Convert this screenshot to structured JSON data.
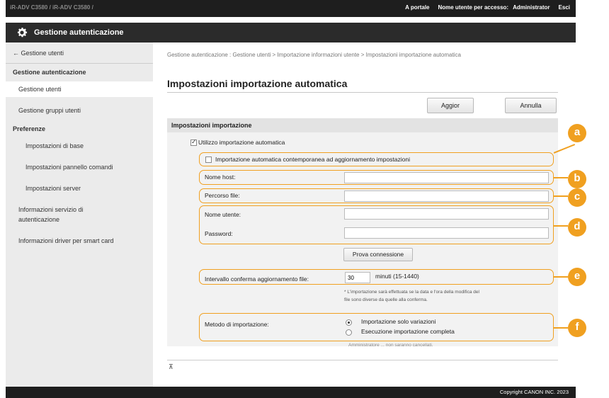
{
  "topbar": {
    "device_name": "iR-ADV C3580 / iR-ADV C3580 /",
    "portal_link": "A portale",
    "user_label": "Nome utente per accesso:",
    "user_value": "Administrator",
    "logout_link": "Esci"
  },
  "titlebar": {
    "title": "Gestione autenticazione",
    "icon": "gear-icon"
  },
  "sidebar": {
    "back_link": "← Gestione utenti",
    "section_auth": "Gestione autenticazione",
    "item_users": "Gestione utenti",
    "item_groups": "Gestione gruppi utenti",
    "section_pref": "Preferenze",
    "item_basic": "Impostazioni di base",
    "item_panel": "Impostazioni pannello comandi",
    "item_server": "Impostazioni server",
    "item_service_info_line1": "Informazioni servizio di",
    "item_service_info_line2": "autenticazione",
    "item_driver": "Informazioni driver per smart card"
  },
  "main": {
    "breadcrumb": "Gestione autenticazione : Gestione utenti > Importazione informazioni utente > Impostazioni importazione automatica",
    "page_title": "Impostazioni importazione automatica",
    "update_button": "Aggior",
    "cancel_button": "Annulla"
  },
  "form": {
    "section_title": "Impostazioni importazione",
    "use_auto_import_label": "Utilizzo importazione automatica",
    "use_auto_import_checked": true,
    "import_on_update_label": "Importazione automatica contemporanea ad aggiornamento impostazioni",
    "import_on_update_checked": false,
    "host_label": "Nome host:",
    "host_value": "",
    "path_label": "Percorso file:",
    "path_value": "",
    "username_label": "Nome utente:",
    "username_value": "",
    "password_label": "Password:",
    "password_value": "",
    "test_connection_button": "Prova connessione",
    "interval_label": "Intervallo conferma aggiornamento file:",
    "interval_value": "30",
    "interval_unit": "minuti (15-1440)",
    "note_line1": "* L'importazione sarà effettuata se la data e l'ora della modifica del",
    "note_line2": "file sono diverse da quelle alla conferma.",
    "method_label": "Metodo di importazione:",
    "method_options": [
      "Importazione solo variazioni",
      "Esecuzione importazione completa"
    ],
    "method_selected": "Importazione solo variazioni",
    "obscured_text": "Amministratore ... non saranno cancellati."
  },
  "callouts": [
    "a",
    "b",
    "c",
    "d",
    "e",
    "f"
  ],
  "footer": {
    "copyright": "Copyright CANON INC. 2023"
  },
  "colors": {
    "callout": "#f0a020",
    "topbar": "#1e1e1e",
    "titlebar": "#2b2b2b",
    "sidebar": "#ebebeb"
  }
}
